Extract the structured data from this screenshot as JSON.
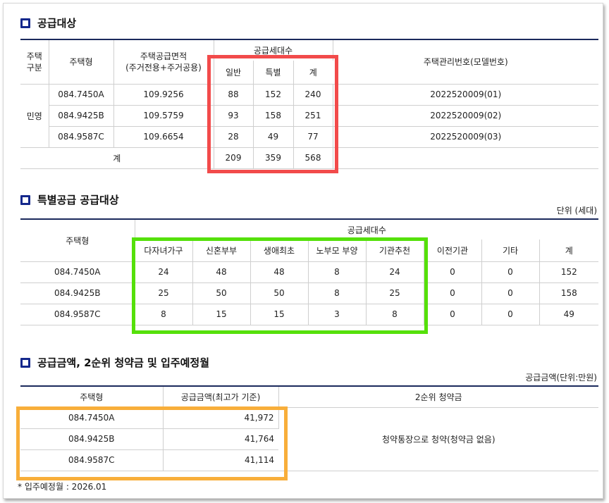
{
  "section1": {
    "title": "공급대상",
    "headers": {
      "house_type_cat": "주택\n구분",
      "house_type": "주택형",
      "area": "주택공급면적\n(주거전용+주거공용)",
      "units": "공급세대수",
      "general": "일반",
      "special": "특별",
      "total": "계",
      "mgmt_no": "주택관리번호(모델번호)"
    },
    "category": "민영",
    "rows": [
      {
        "type": "084.7450A",
        "area": "109.9256",
        "general": "88",
        "special": "152",
        "total": "240",
        "mgmt": "2022520009(01)"
      },
      {
        "type": "084.9425B",
        "area": "109.5759",
        "general": "93",
        "special": "158",
        "total": "251",
        "mgmt": "2022520009(02)"
      },
      {
        "type": "084.9587C",
        "area": "109.6654",
        "general": "28",
        "special": "49",
        "total": "77",
        "mgmt": "2022520009(03)"
      }
    ],
    "total_row": {
      "label": "계",
      "general": "209",
      "special": "359",
      "total": "568"
    }
  },
  "section2": {
    "title": "특별공급 공급대상",
    "unit": "단위 (세대)",
    "headers": {
      "house_type": "주택형",
      "units": "공급세대수",
      "multi_child": "다자녀가구",
      "newlywed": "신혼부부",
      "first_life": "생애최초",
      "elderly": "노부모 부양",
      "institution": "기관추천",
      "relocation": "이전기관",
      "other": "기타",
      "total": "계"
    },
    "rows": [
      {
        "type": "084.7450A",
        "multi_child": "24",
        "newlywed": "48",
        "first_life": "48",
        "elderly": "8",
        "institution": "24",
        "relocation": "0",
        "other": "0",
        "total": "152"
      },
      {
        "type": "084.9425B",
        "multi_child": "25",
        "newlywed": "50",
        "first_life": "50",
        "elderly": "8",
        "institution": "25",
        "relocation": "0",
        "other": "0",
        "total": "158"
      },
      {
        "type": "084.9587C",
        "multi_child": "8",
        "newlywed": "15",
        "first_life": "15",
        "elderly": "3",
        "institution": "8",
        "relocation": "0",
        "other": "0",
        "total": "49"
      }
    ]
  },
  "section3": {
    "title": "공급금액, 2순위 청약금 및 입주예정월",
    "unit": "공급금액(단위:만원)",
    "headers": {
      "house_type": "주택형",
      "price": "공급금액(최고가 기준)",
      "deposit": "2순위 청약금"
    },
    "rows": [
      {
        "type": "084.7450A",
        "price": "41,972"
      },
      {
        "type": "084.9425B",
        "price": "41,764"
      },
      {
        "type": "084.9587C",
        "price": "41,114"
      }
    ],
    "deposit_text": "청약통장으로 청약(청약금 없음)",
    "note": "* 입주예정월 : 2026.01"
  },
  "highlight_colors": {
    "red": "#f24b4b",
    "green": "#55e00a",
    "orange": "#f8ae3a"
  }
}
